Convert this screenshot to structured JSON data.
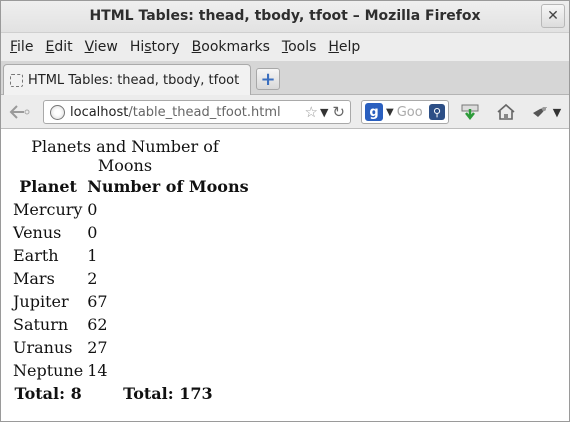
{
  "window": {
    "title": "HTML Tables: thead, tbody, tfoot – Mozilla Firefox",
    "close_glyph": "✕"
  },
  "menu": [
    {
      "mnemonic": "F",
      "rest": "ile"
    },
    {
      "mnemonic": "E",
      "rest": "dit"
    },
    {
      "mnemonic": "V",
      "rest": "iew"
    },
    {
      "mnemonic": "",
      "rest": "History",
      "pre": "Hi",
      "mn2": "s",
      "post": "tory"
    },
    {
      "mnemonic": "B",
      "rest": "ookmarks"
    },
    {
      "mnemonic": "T",
      "rest": "ools"
    },
    {
      "mnemonic": "H",
      "rest": "elp"
    }
  ],
  "tab": {
    "label": "HTML Tables: thead, tbody, tfoot",
    "new_tab_glyph": "+"
  },
  "navbar": {
    "url_host": "localhost",
    "url_path": "/table_thead_tfoot.html",
    "search_placeholder": "Goo",
    "search_engine_glyph": "g"
  },
  "page": {
    "caption": "Planets and Number of Moons",
    "headers": [
      "Planet",
      "Number of Moons"
    ],
    "rows": [
      [
        "Mercury",
        "0"
      ],
      [
        "Venus",
        "0"
      ],
      [
        "Earth",
        "1"
      ],
      [
        "Mars",
        "2"
      ],
      [
        "Jupiter",
        "67"
      ],
      [
        "Saturn",
        "62"
      ],
      [
        "Uranus",
        "27"
      ],
      [
        "Neptune",
        "14"
      ]
    ],
    "footer": [
      "Total: 8",
      "Total: 173"
    ]
  }
}
